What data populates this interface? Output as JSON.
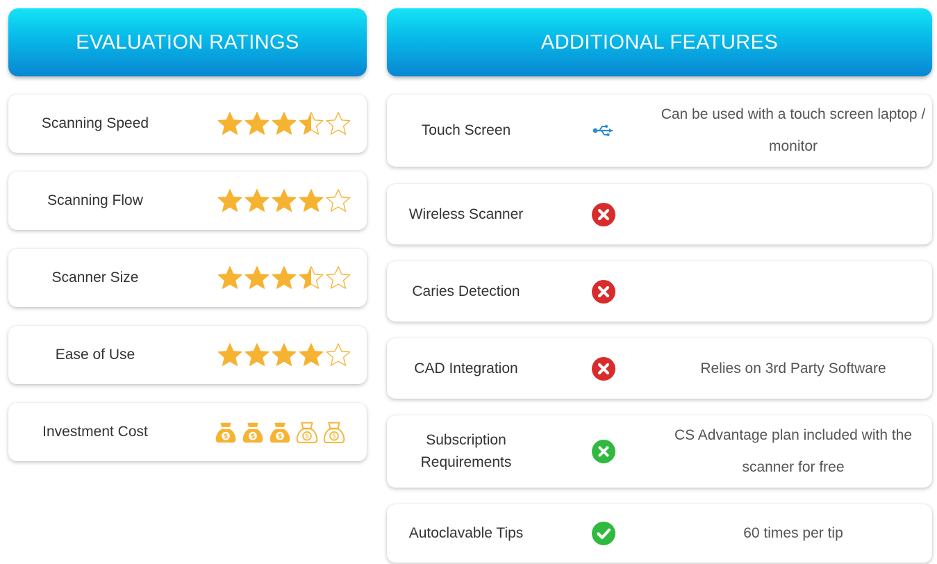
{
  "headers": {
    "ratings": "EVALUATION RATINGS",
    "features": "ADDITIONAL FEATURES"
  },
  "colors": {
    "header_top": "#14e3f5",
    "header_bottom": "#0a86d2",
    "star": "#f6b332",
    "no": "#d92b2b",
    "yes": "#2fba3f",
    "usb": "#2c8bd6"
  },
  "ratings": [
    {
      "label": "Scanning Speed",
      "value": 3.5,
      "max": 5,
      "kind": "star"
    },
    {
      "label": "Scanning Flow",
      "value": 4,
      "max": 5,
      "kind": "star"
    },
    {
      "label": "Scanner Size",
      "value": 3.5,
      "max": 5,
      "kind": "star"
    },
    {
      "label": "Ease of Use",
      "value": 4,
      "max": 5,
      "kind": "star"
    },
    {
      "label": "Investment Cost",
      "value": 3,
      "max": 5,
      "kind": "money-bag"
    }
  ],
  "features": [
    {
      "label": "Touch Screen",
      "icon": "usb-icon",
      "note": "Can be used with a touch screen laptop / monitor"
    },
    {
      "label": "Wireless Scanner",
      "icon": "x-circle-red-icon",
      "note": ""
    },
    {
      "label": "Caries Detection",
      "icon": "x-circle-red-icon",
      "note": ""
    },
    {
      "label": "CAD Integration",
      "icon": "x-circle-red-icon",
      "note": "Relies on 3rd Party Software"
    },
    {
      "label": "Subscription Requirements",
      "icon": "x-circle-green-icon",
      "note": "CS Advantage plan included with the scanner for free"
    },
    {
      "label": "Autoclavable Tips",
      "icon": "check-circle-green-icon",
      "note": "60 times per tip"
    }
  ]
}
